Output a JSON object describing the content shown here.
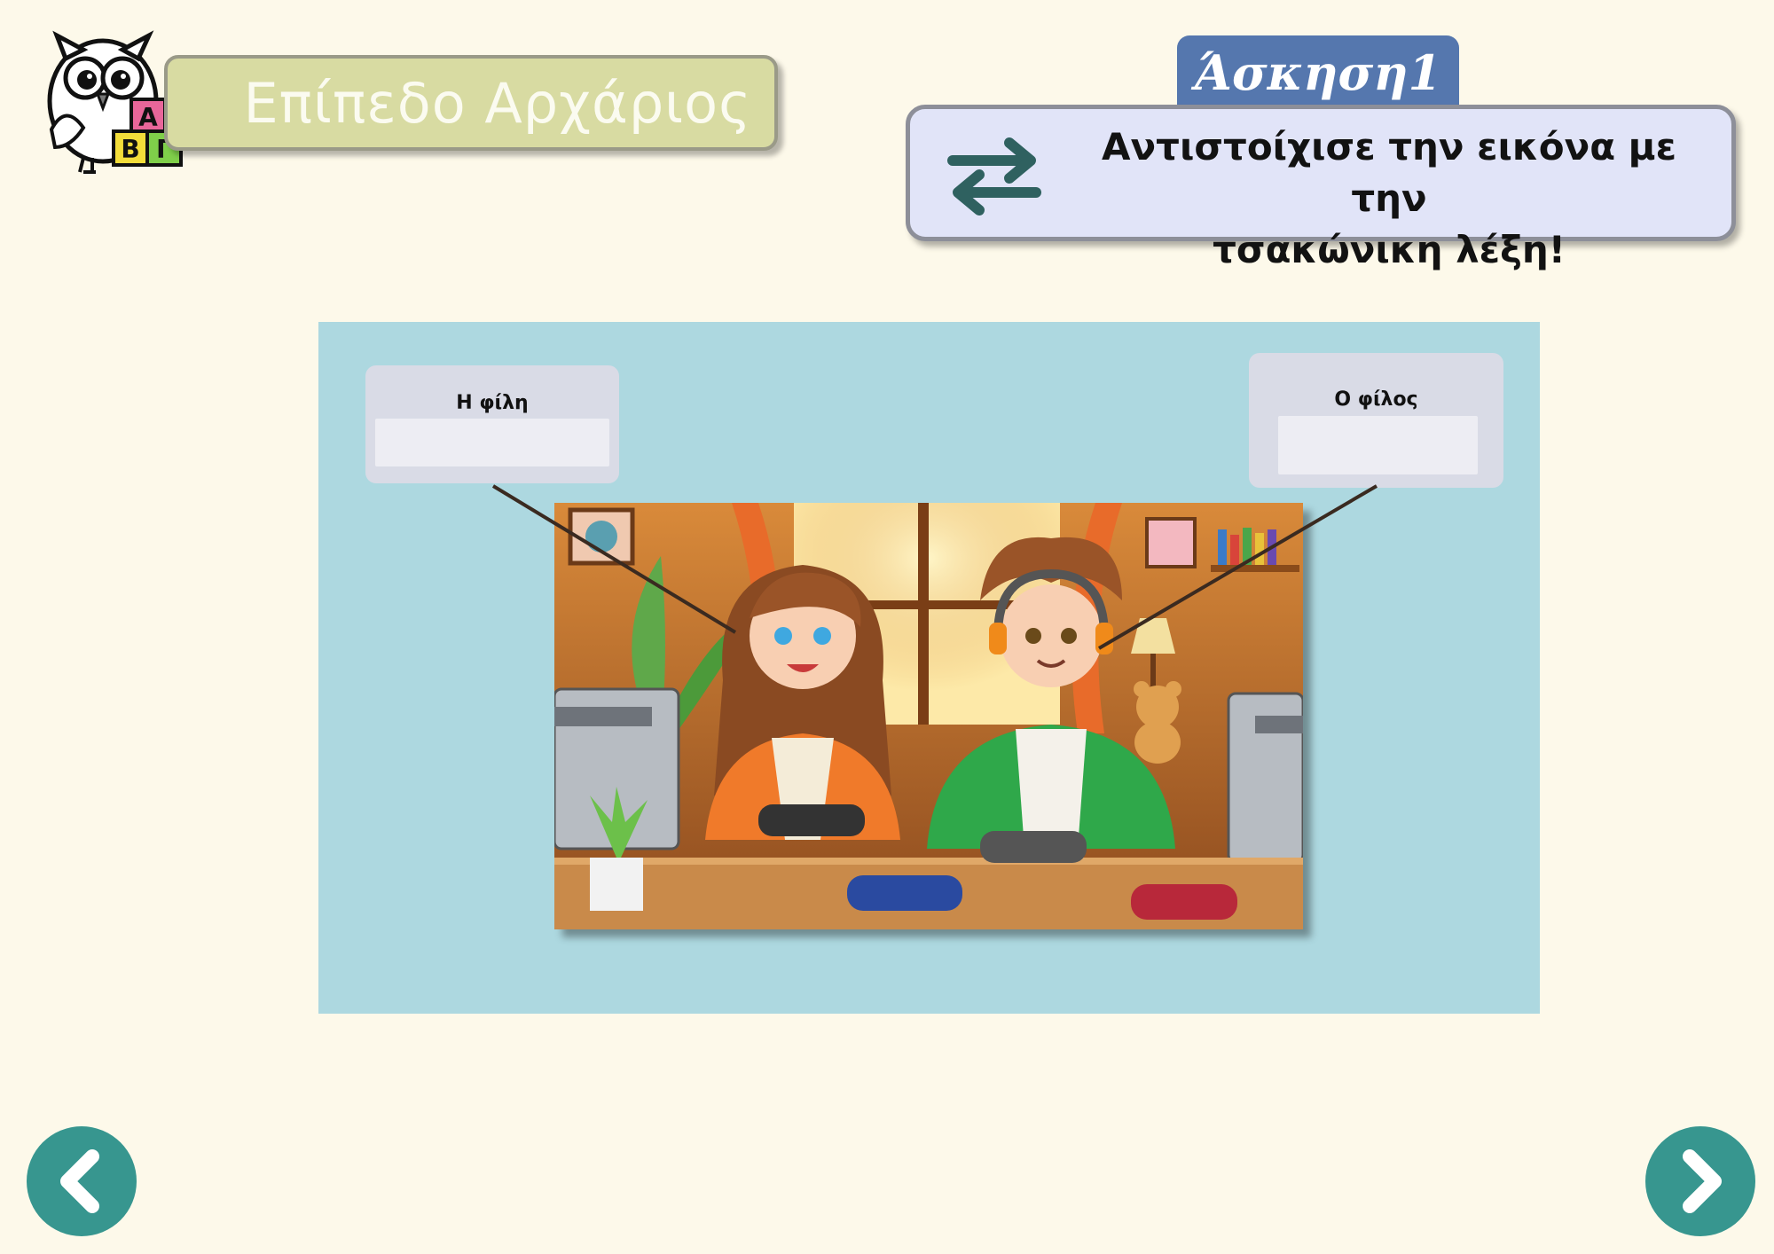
{
  "header": {
    "level_title": "Επίπεδο Αρχάριος",
    "logo_letters": [
      "Α",
      "Β",
      "Γ"
    ]
  },
  "exercise": {
    "label": "Άσκηση1",
    "instruction_line1": "Αντιστοίχισε την εικόνα με την",
    "instruction_line2": "τσακώνικη λέξη!"
  },
  "activity": {
    "cards": [
      {
        "label": "Η φίλη",
        "answer": ""
      },
      {
        "label": "Ο φίλος",
        "answer": ""
      }
    ],
    "image_subject": "girl and boy playing video games"
  },
  "navigation": {
    "prev_icon": "chevron-left-icon",
    "next_icon": "chevron-right-icon"
  },
  "colors": {
    "background": "#fdf9ea",
    "panel": "#add8e0",
    "level_banner": "#d8dba2",
    "exercise_tab": "#5577ae",
    "instruction_box": "#e1e4f8",
    "nav_button": "#37968f"
  }
}
